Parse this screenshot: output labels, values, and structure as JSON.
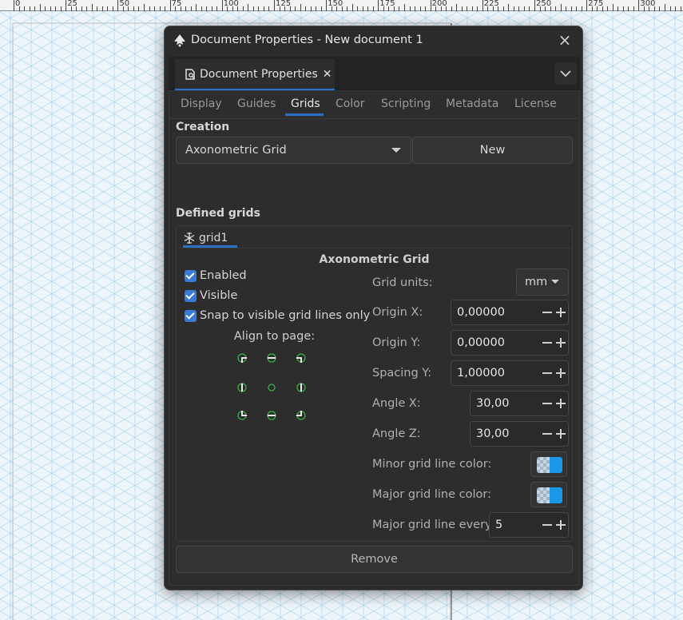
{
  "ruler": {
    "labels": [
      "0",
      "25",
      "50",
      "75",
      "100",
      "125",
      "150",
      "175",
      "200",
      "225",
      "250",
      "275",
      "300"
    ]
  },
  "window": {
    "title": "Document Properties - New document 1",
    "close_icon": "close-icon"
  },
  "dock": {
    "tab_label": "Document Properties",
    "tab_close": "✕",
    "menu_icon": "chevron-down-icon"
  },
  "tabs": [
    {
      "label": "Display",
      "active": false
    },
    {
      "label": "Guides",
      "active": false
    },
    {
      "label": "Grids",
      "active": true
    },
    {
      "label": "Color",
      "active": false
    },
    {
      "label": "Scripting",
      "active": false
    },
    {
      "label": "Metadata",
      "active": false
    },
    {
      "label": "License",
      "active": false
    }
  ],
  "creation": {
    "title": "Creation",
    "grid_type": "Axonometric Grid",
    "new_label": "New"
  },
  "defined": {
    "title": "Defined grids",
    "grid_tab": "grid1",
    "grid_heading": "Axonometric Grid",
    "checks": {
      "enabled": "Enabled",
      "visible": "Visible",
      "snap": "Snap to visible grid lines only"
    },
    "align_label": "Align to page:",
    "fields": {
      "units_label": "Grid units:",
      "units_value": "mm",
      "origin_x_label": "Origin X:",
      "origin_x_value": "0,00000",
      "origin_y_label": "Origin Y:",
      "origin_y_value": "0,00000",
      "spacing_y_label": "Spacing Y:",
      "spacing_y_value": "1,00000",
      "angle_x_label": "Angle X:",
      "angle_x_value": "30,00",
      "angle_z_label": "Angle Z:",
      "angle_z_value": "30,00",
      "minor_color_label": "Minor grid line color:",
      "major_color_label": "Major grid line color:",
      "major_every_label": "Major grid line every:",
      "major_every_value": "5"
    },
    "remove_label": "Remove"
  },
  "colors": {
    "accent": "#2b6fc6",
    "grid_line": "#9fd3ef",
    "swatch_blue": "#1b98e8",
    "align_dot": "#3bb54a"
  }
}
